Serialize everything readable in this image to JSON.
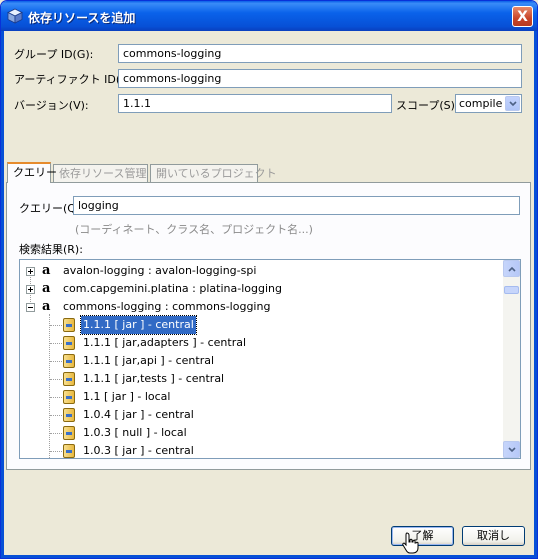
{
  "window": {
    "title": "依存リソースを追加",
    "close_glyph": "X"
  },
  "form": {
    "group_label": "グループ ID(G):",
    "group_value": "commons-logging",
    "artifact_label": "アーティファクト ID(A):",
    "artifact_value": "commons-logging",
    "version_label": "バージョン(V):",
    "version_value": "1.1.1",
    "scope_label": "スコープ(S):",
    "scope_value": "compile"
  },
  "tabs": [
    {
      "label": "クエリー",
      "active": true
    },
    {
      "label": "依存リソース管理",
      "active": false
    },
    {
      "label": "開いているプロジェクト",
      "active": false
    }
  ],
  "query": {
    "label": "クエリー(Q):",
    "value": "logging",
    "hint": "(コーディネート、クラス名、プロジェクト名...)",
    "results_label": "検索結果(R):"
  },
  "results": [
    {
      "text": "avalon-logging : avalon-logging-spi",
      "kind": "artifact",
      "expander": "plus"
    },
    {
      "text": "com.capgemini.platina : platina-logging",
      "kind": "artifact",
      "expander": "plus"
    },
    {
      "text": "commons-logging : commons-logging",
      "kind": "artifact",
      "expander": "minus"
    },
    {
      "text": "1.1.1 [ jar ] - central",
      "kind": "version",
      "selected": true
    },
    {
      "text": "1.1.1 [ jar,adapters ] - central",
      "kind": "version"
    },
    {
      "text": "1.1.1 [ jar,api ] - central",
      "kind": "version"
    },
    {
      "text": "1.1.1 [ jar,tests ] - central",
      "kind": "version"
    },
    {
      "text": "1.1 [ jar ] - local",
      "kind": "version"
    },
    {
      "text": "1.0.4 [ jar ] - central",
      "kind": "version"
    },
    {
      "text": "1.0.3 [ null ] - local",
      "kind": "version"
    },
    {
      "text": "1.0.3 [ jar ] - central",
      "kind": "version"
    }
  ],
  "buttons": {
    "ok": "了解",
    "cancel": "取消し"
  },
  "icons": {
    "window": "cube-icon",
    "artifact": "letter-a-icon",
    "version": "jar-icon",
    "cursor": "hand-pointer-icon"
  },
  "colors": {
    "titlebar": "#0a5fe8",
    "selection": "#316ac5",
    "active_tab_accent": "#e68b2c",
    "dialog_bg": "#ece9d8"
  }
}
